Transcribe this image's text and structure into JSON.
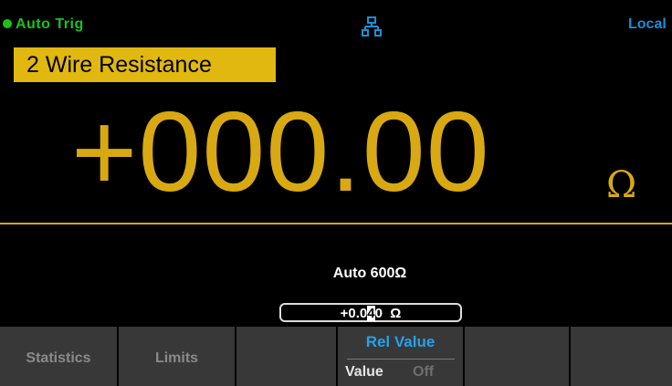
{
  "status": {
    "trigger_mode": "Auto Trig",
    "network_icon": "lan-network-icon",
    "remote_state": "Local"
  },
  "measurement": {
    "function_name": "2 Wire Resistance",
    "reading": "+000.00",
    "unit": "Ω"
  },
  "range": {
    "label": "Auto 600Ω"
  },
  "rel_input": {
    "prefix": "+0.0",
    "cursor_digit": "4",
    "suffix": "0  Ω"
  },
  "softkeys": {
    "statistics": "Statistics",
    "limits": "Limits",
    "rel_value": {
      "title": "Rel Value",
      "option_on": "Value",
      "option_off": "Off"
    }
  },
  "colors": {
    "accent_yellow": "#e1b80f",
    "trigger_green": "#18c418",
    "highlight_blue": "#27a1e8",
    "softkey_bg": "#383838"
  }
}
